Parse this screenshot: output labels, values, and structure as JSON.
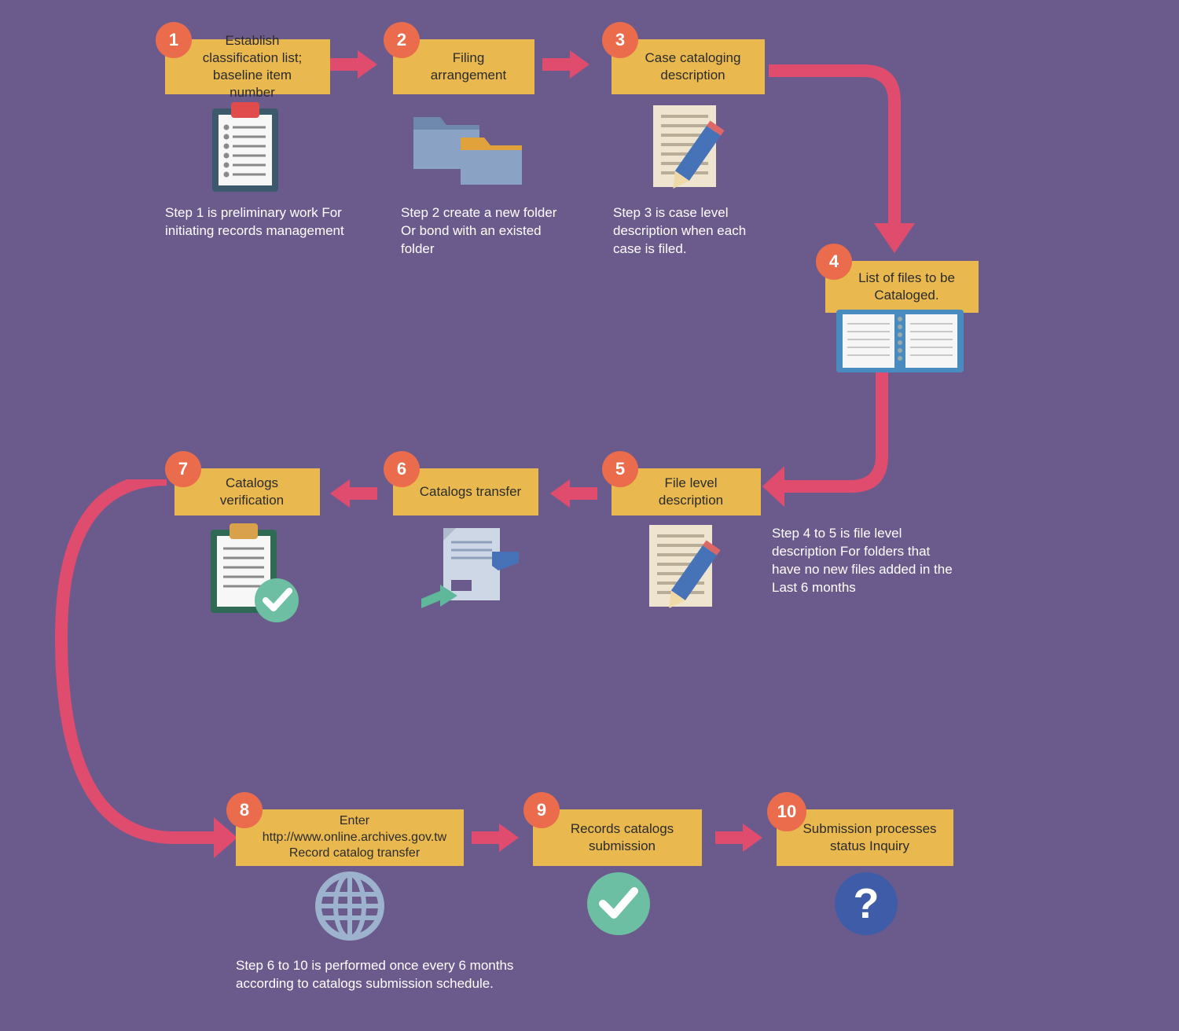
{
  "steps": {
    "s1": {
      "num": "1",
      "title": "Establish classification list; baseline item number"
    },
    "s2": {
      "num": "2",
      "title": "Filing arrangement"
    },
    "s3": {
      "num": "3",
      "title": "Case cataloging description"
    },
    "s4": {
      "num": "4",
      "title": "List of files to be Cataloged."
    },
    "s5": {
      "num": "5",
      "title": "File level description"
    },
    "s6": {
      "num": "6",
      "title": "Catalogs transfer"
    },
    "s7": {
      "num": "7",
      "title": "Catalogs verification"
    },
    "s8": {
      "num": "8",
      "title": "Enter http://www.online.archives.gov.tw Record catalog transfer"
    },
    "s9": {
      "num": "9",
      "title": "Records catalogs submission"
    },
    "s10": {
      "num": "10",
      "title": "Submission processes status Inquiry"
    }
  },
  "descs": {
    "d1": "Step 1 is preliminary work For initiating records management",
    "d2": "Step 2 create a new folder Or bond with an existed folder",
    "d3": "Step 3 is case level description when each case is filed.",
    "d5": "Step 4 to 5 is file level description For folders that have no new files added in the Last 6 months",
    "d8": "Step 6 to 10 is performed once every 6 months according to catalogs submission schedule."
  }
}
